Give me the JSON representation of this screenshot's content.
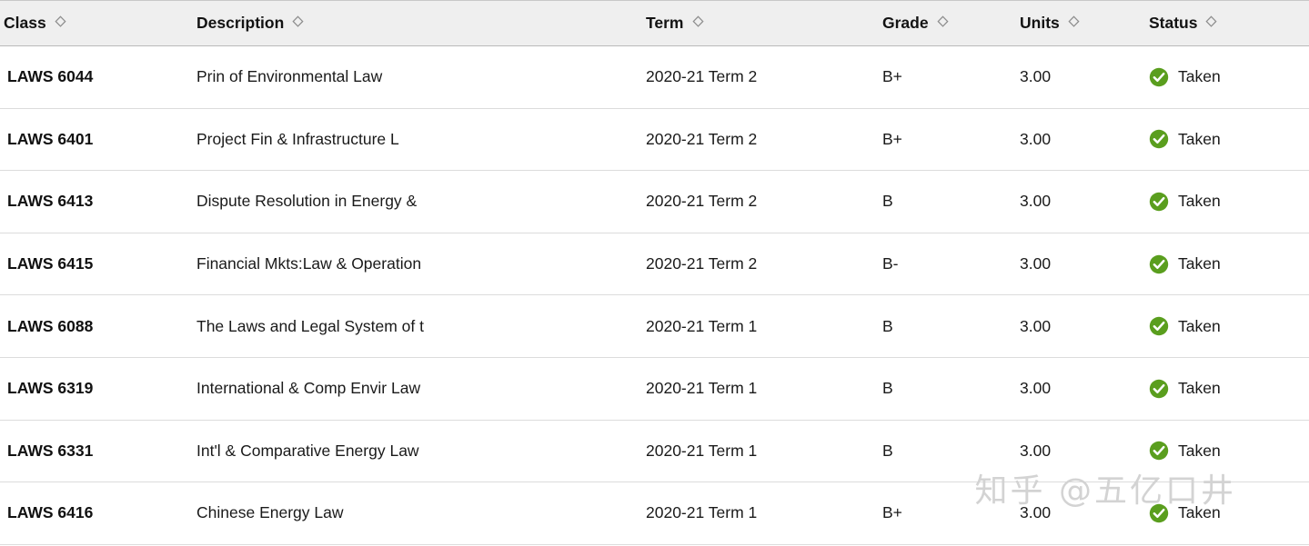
{
  "table": {
    "columns": [
      {
        "key": "class",
        "label": "Class",
        "sortable": true,
        "sort_icon": "sort-diamond-icon"
      },
      {
        "key": "description",
        "label": "Description",
        "sortable": true,
        "sort_icon": "sort-diamond-icon"
      },
      {
        "key": "term",
        "label": "Term",
        "sortable": true,
        "sort_icon": "sort-diamond-icon"
      },
      {
        "key": "grade",
        "label": "Grade",
        "sortable": true,
        "sort_icon": "sort-diamond-icon"
      },
      {
        "key": "units",
        "label": "Units",
        "sortable": true,
        "sort_icon": "sort-diamond-icon"
      },
      {
        "key": "status",
        "label": "Status",
        "sortable": true,
        "sort_icon": "sort-diamond-icon"
      }
    ],
    "rows": [
      {
        "class": "LAWS 6044",
        "description": "Prin of Environmental Law",
        "term": "2020-21 Term 2",
        "grade": "B+",
        "units": "3.00",
        "status": "Taken",
        "status_icon": "check-circle-icon"
      },
      {
        "class": "LAWS 6401",
        "description": "Project Fin & Infrastructure L",
        "term": "2020-21 Term 2",
        "grade": "B+",
        "units": "3.00",
        "status": "Taken",
        "status_icon": "check-circle-icon"
      },
      {
        "class": "LAWS 6413",
        "description": "Dispute Resolution in Energy &",
        "term": "2020-21 Term 2",
        "grade": "B",
        "units": "3.00",
        "status": "Taken",
        "status_icon": "check-circle-icon"
      },
      {
        "class": "LAWS 6415",
        "description": "Financial Mkts:Law & Operation",
        "term": "2020-21 Term 2",
        "grade": "B-",
        "units": "3.00",
        "status": "Taken",
        "status_icon": "check-circle-icon"
      },
      {
        "class": "LAWS 6088",
        "description": "The Laws and Legal System of t",
        "term": "2020-21 Term 1",
        "grade": "B",
        "units": "3.00",
        "status": "Taken",
        "status_icon": "check-circle-icon"
      },
      {
        "class": "LAWS 6319",
        "description": "International & Comp Envir Law",
        "term": "2020-21 Term 1",
        "grade": "B",
        "units": "3.00",
        "status": "Taken",
        "status_icon": "check-circle-icon"
      },
      {
        "class": "LAWS 6331",
        "description": "Int'l & Comparative Energy Law",
        "term": "2020-21 Term 1",
        "grade": "B",
        "units": "3.00",
        "status": "Taken",
        "status_icon": "check-circle-icon"
      },
      {
        "class": "LAWS 6416",
        "description": "Chinese Energy Law",
        "term": "2020-21 Term 1",
        "grade": "B+",
        "units": "3.00",
        "status": "Taken",
        "status_icon": "check-circle-icon"
      }
    ]
  },
  "watermark": {
    "text": "知乎 @五亿口井"
  },
  "colors": {
    "header_background": "#efefef",
    "header_border": "#b9b9b9",
    "row_divider": "#dcdcdc",
    "row_background": "#ffffff",
    "text": "#1a1a1a",
    "status_green": "#5a9e1e",
    "watermark": "#d3d3d3"
  }
}
